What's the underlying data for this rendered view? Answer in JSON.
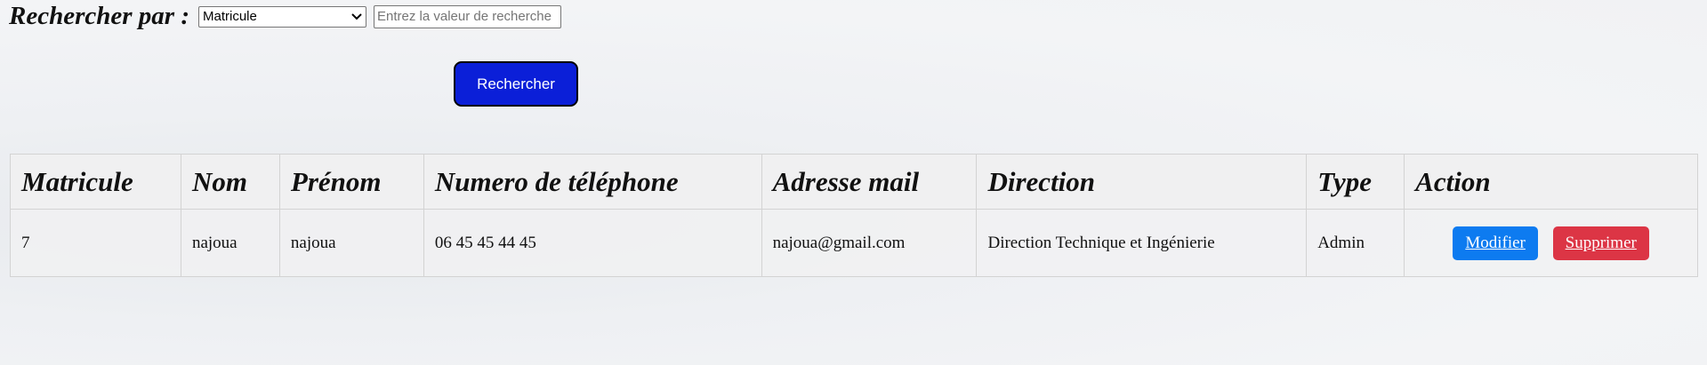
{
  "search": {
    "label": "Rechercher par :",
    "criteria_selected": "Matricule",
    "input_placeholder": "Entrez la valeur de recherche",
    "input_value": "",
    "button_label": "Rechercher"
  },
  "table": {
    "headers": [
      "Matricule",
      "Nom",
      "Prénom",
      "Numero de téléphone",
      "Adresse mail",
      "Direction",
      "Type",
      "Action"
    ],
    "rows": [
      {
        "matricule": "7",
        "nom": "najoua",
        "prenom": "najoua",
        "telephone": "06 45 45 44 45",
        "email": "najoua@gmail.com",
        "direction": "Direction Technique et Ingénierie",
        "type": "Admin",
        "edit_label": "Modifier",
        "delete_label": "Supprimer"
      }
    ]
  },
  "colors": {
    "search_button": "#0b1fd8",
    "edit_button": "#0d7bf0",
    "delete_button": "#dc3545"
  },
  "icons": {
    "select_chevron": "chevron-down-icon"
  }
}
